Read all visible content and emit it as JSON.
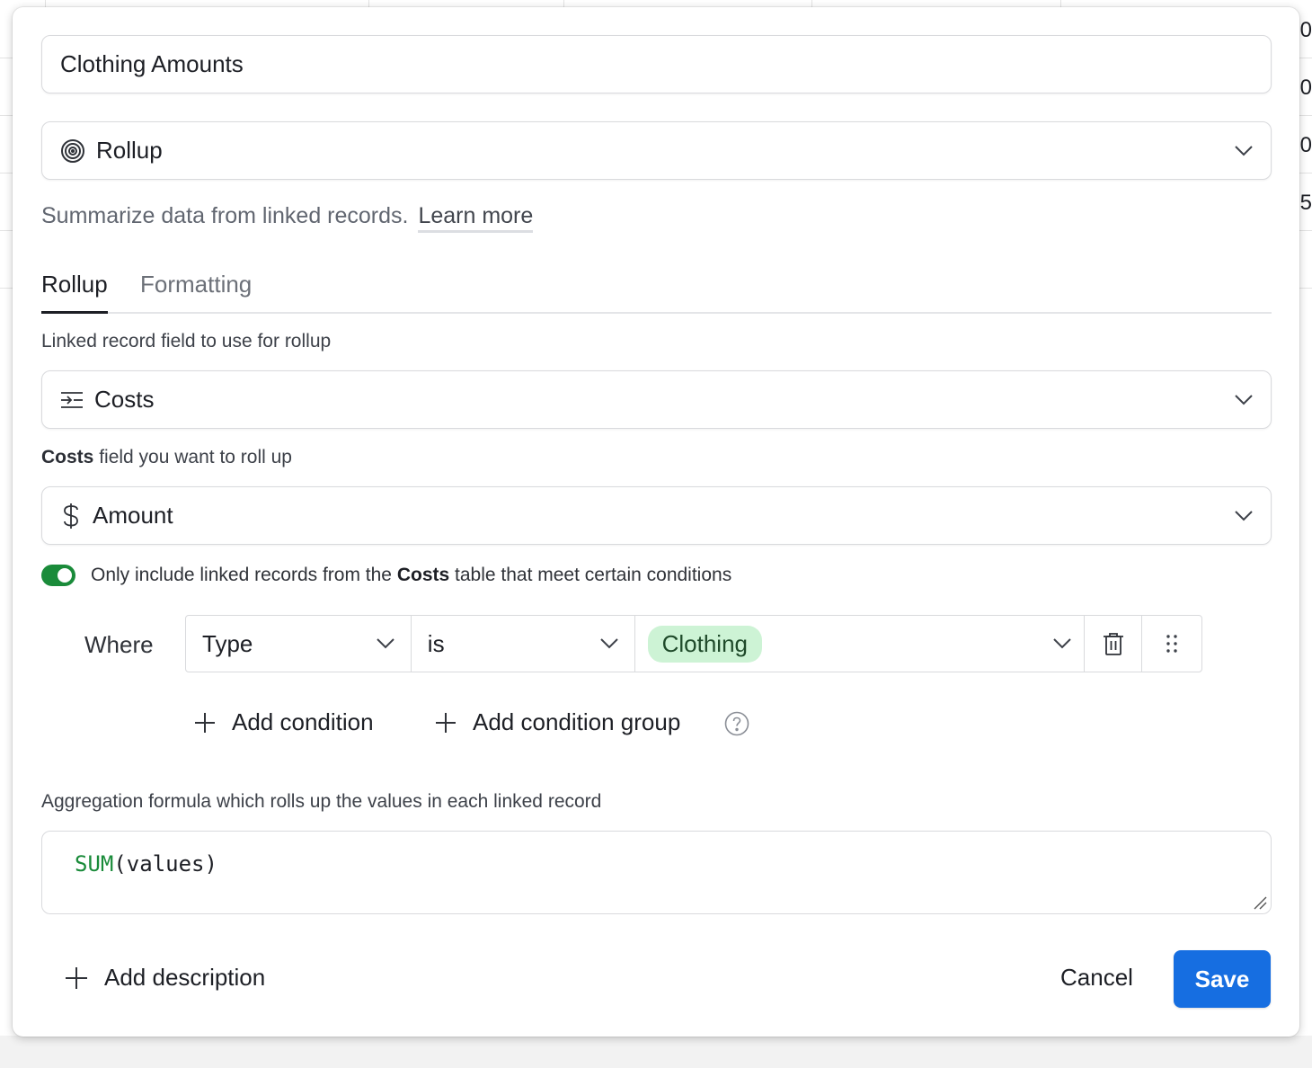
{
  "background": {
    "right_column_values": [
      "0",
      "0",
      "0",
      "5"
    ]
  },
  "field_name": "Clothing Amounts",
  "field_type": {
    "label": "Rollup",
    "icon": "rollup-spiral-icon"
  },
  "description_hint": {
    "text": "Summarize data from linked records.",
    "link": "Learn more"
  },
  "tabs": [
    {
      "label": "Rollup",
      "active": true
    },
    {
      "label": "Formatting",
      "active": false
    }
  ],
  "linked_record": {
    "label": "Linked record field to use for rollup",
    "selected": "Costs",
    "icon": "linked-record-icon"
  },
  "rollup_field": {
    "label_bold": "Costs",
    "label_rest": " field you want to roll up",
    "selected": "Amount",
    "icon": "dollar-icon"
  },
  "conditions": {
    "toggle_on": true,
    "text_before": "Only include linked records from the ",
    "table": "Costs",
    "text_after": " table that meet certain conditions",
    "where_label": "Where",
    "field": "Type",
    "operator": "is",
    "value": "Clothing",
    "add_condition": "Add condition",
    "add_condition_group": "Add condition group"
  },
  "aggregation": {
    "label": "Aggregation formula which rolls up the values in each linked record",
    "function": "SUM",
    "args": "(values)"
  },
  "footer": {
    "add_description": "Add description",
    "cancel": "Cancel",
    "save": "Save"
  },
  "colors": {
    "accent_blue": "#166ee1",
    "toggle_green": "#1a8b3a",
    "pill_green": "#cdf3d5"
  }
}
